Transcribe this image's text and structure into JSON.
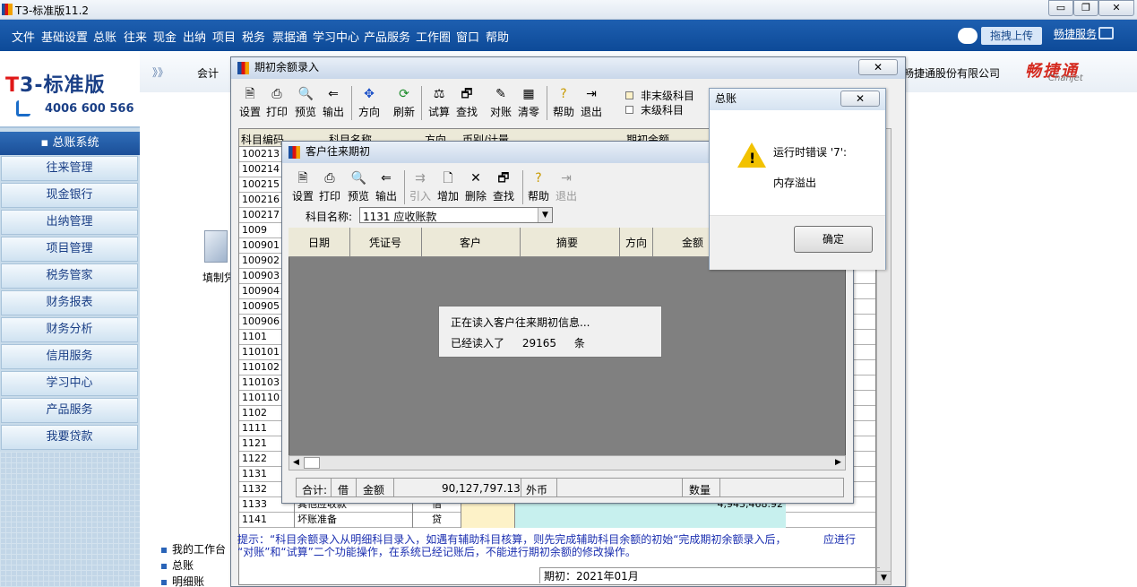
{
  "app": {
    "title": "T3-标准版11.2"
  },
  "menu": [
    "文件",
    "基础设置",
    "总账",
    "往来",
    "现金",
    "出纳",
    "项目",
    "税务",
    "票据通",
    "学习中心",
    "产品服务",
    "工作圈",
    "窗口",
    "帮助"
  ],
  "menu_right": {
    "upload": "拖拽上传",
    "tong_service": "畅捷服务"
  },
  "logo": {
    "brand_t": "T",
    "brand_rest": "3-标准版",
    "phone": "4006 600 566"
  },
  "nav": {
    "head": "总账系统",
    "items": [
      "往来管理",
      "现金银行",
      "出纳管理",
      "项目管理",
      "税务管家",
      "财务报表",
      "财务分析",
      "信用服务",
      "学习中心",
      "产品服务",
      "我要贷款"
    ]
  },
  "desk": {
    "arrows": "》》",
    "tab_kuaiji": "会计",
    "company": "畅捷通股份有限公司",
    "brand_cn": "畅捷通",
    "brand_en": "Chanjet",
    "fill_label": "填制凭",
    "bottom_menu": [
      "我的工作台",
      "总账",
      "明细账"
    ]
  },
  "balance_window": {
    "title": "期初余额录入",
    "toolbar": [
      "设置",
      "打印",
      "预览",
      "输出",
      "方向",
      "刷新",
      "试算",
      "查找",
      "对账",
      "清零",
      "帮助",
      "退出"
    ],
    "legend": {
      "non_leaf": "非末级科目",
      "leaf": "末级科目"
    },
    "columns": {
      "code": "科目编码",
      "name": "科目名称",
      "dir": "方向",
      "cur": "币别/计量",
      "amount": "期初余额"
    },
    "rows": [
      {
        "code": "100213",
        "name": "",
        "dir": "",
        "amount": ""
      },
      {
        "code": "100214",
        "name": "",
        "dir": "",
        "amount": ""
      },
      {
        "code": "100215",
        "name": "",
        "dir": "",
        "amount": ""
      },
      {
        "code": "100216",
        "name": "",
        "dir": "",
        "amount": ""
      },
      {
        "code": "100217",
        "name": "",
        "dir": "",
        "amount": ""
      },
      {
        "code": "1009",
        "name": "",
        "dir": "",
        "amount": ""
      },
      {
        "code": "100901",
        "name": "",
        "dir": "",
        "amount": ""
      },
      {
        "code": "100902",
        "name": "",
        "dir": "",
        "amount": ""
      },
      {
        "code": "100903",
        "name": "",
        "dir": "",
        "amount": ""
      },
      {
        "code": "100904",
        "name": "",
        "dir": "",
        "amount": ""
      },
      {
        "code": "100905",
        "name": "",
        "dir": "",
        "amount": ""
      },
      {
        "code": "100906",
        "name": "",
        "dir": "",
        "amount": ""
      },
      {
        "code": "1101",
        "name": "",
        "dir": "",
        "amount": ""
      },
      {
        "code": "110101",
        "name": "",
        "dir": "",
        "amount": ""
      },
      {
        "code": "110102",
        "name": "",
        "dir": "",
        "amount": ""
      },
      {
        "code": "110103",
        "name": "",
        "dir": "",
        "amount": ""
      },
      {
        "code": "110110",
        "name": "",
        "dir": "",
        "amount": ""
      },
      {
        "code": "1102",
        "name": "",
        "dir": "",
        "amount": ""
      },
      {
        "code": "1111",
        "name": "",
        "dir": "",
        "amount": ""
      },
      {
        "code": "1121",
        "name": "",
        "dir": "",
        "amount": ""
      },
      {
        "code": "1122",
        "name": "",
        "dir": "",
        "amount": ""
      },
      {
        "code": "1131",
        "name": "",
        "dir": "",
        "amount": ""
      },
      {
        "code": "1132",
        "name": "",
        "dir": "",
        "amount": ""
      },
      {
        "code": "1133",
        "name": "其他应收款",
        "dir": "借",
        "amount": "4,943,468.92"
      },
      {
        "code": "1141",
        "name": "坏账准备",
        "dir": "贷",
        "amount": ""
      }
    ],
    "hint_line1": "提示：“科目余额录入从明细科目录入，如遇有辅助科目核算，则先完成辅助科目余额的初始“完成期初余额录入后，",
    "hint_right": "应进行",
    "hint_line2": "“对账”和“试算”二个功能操作，在系统已经记账后，不能进行期初余额的修改操作。",
    "period": "期初：2021年01月"
  },
  "customer_window": {
    "title": "客户往来期初",
    "toolbar": [
      "设置",
      "打印",
      "预览",
      "输出",
      "引入",
      "增加",
      "删除",
      "查找",
      "帮助",
      "退出"
    ],
    "subject_label": "科目名称:",
    "subject_value": "1131 应收账款",
    "columns": [
      "日期",
      "凭证号",
      "客户",
      "摘要",
      "方向",
      "金额"
    ],
    "total_label": "合计:",
    "total_dir": "借",
    "total_amount_label": "金额",
    "total_amount": "90,127,797.13",
    "currency_label": "外币",
    "qty_label": "数量",
    "loading_line1": "正在读入客户往来期初信息...",
    "loading_line2_prefix": "已经读入了",
    "loading_count": "29165",
    "loading_unit": "条"
  },
  "error_dialog": {
    "title": "总账",
    "message1": "运行时错误 '7':",
    "message2": "内存溢出",
    "ok": "确定"
  },
  "colors": {
    "menubar": "#0d4a98",
    "amount_cell": "#c7f0ee",
    "currency_cell": "#fdf2c8",
    "hint_text": "#1b2fb0"
  }
}
